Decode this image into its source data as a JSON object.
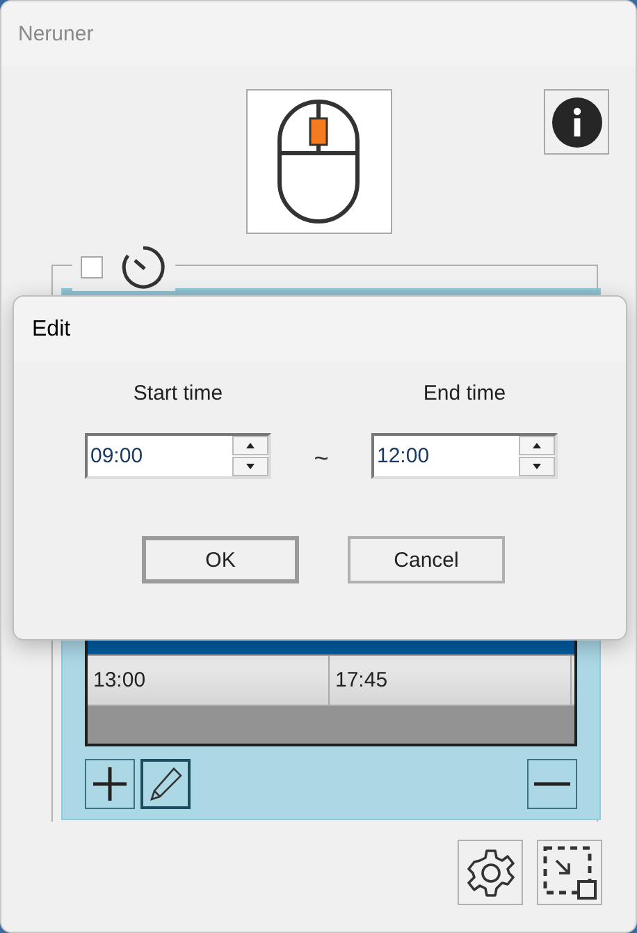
{
  "window": {
    "title": "Neruner"
  },
  "schedule": {
    "checked": false,
    "table": {
      "rows": [
        {
          "selected": true
        },
        {
          "start": "13:00",
          "end": "17:45",
          "selected": false
        }
      ]
    }
  },
  "dialog": {
    "title": "Edit",
    "fields": [
      {
        "label": "Start time",
        "value": "09:00"
      },
      {
        "label": "End time",
        "value": "12:00"
      }
    ],
    "separator": "~",
    "buttons": [
      "OK",
      "Cancel"
    ]
  }
}
